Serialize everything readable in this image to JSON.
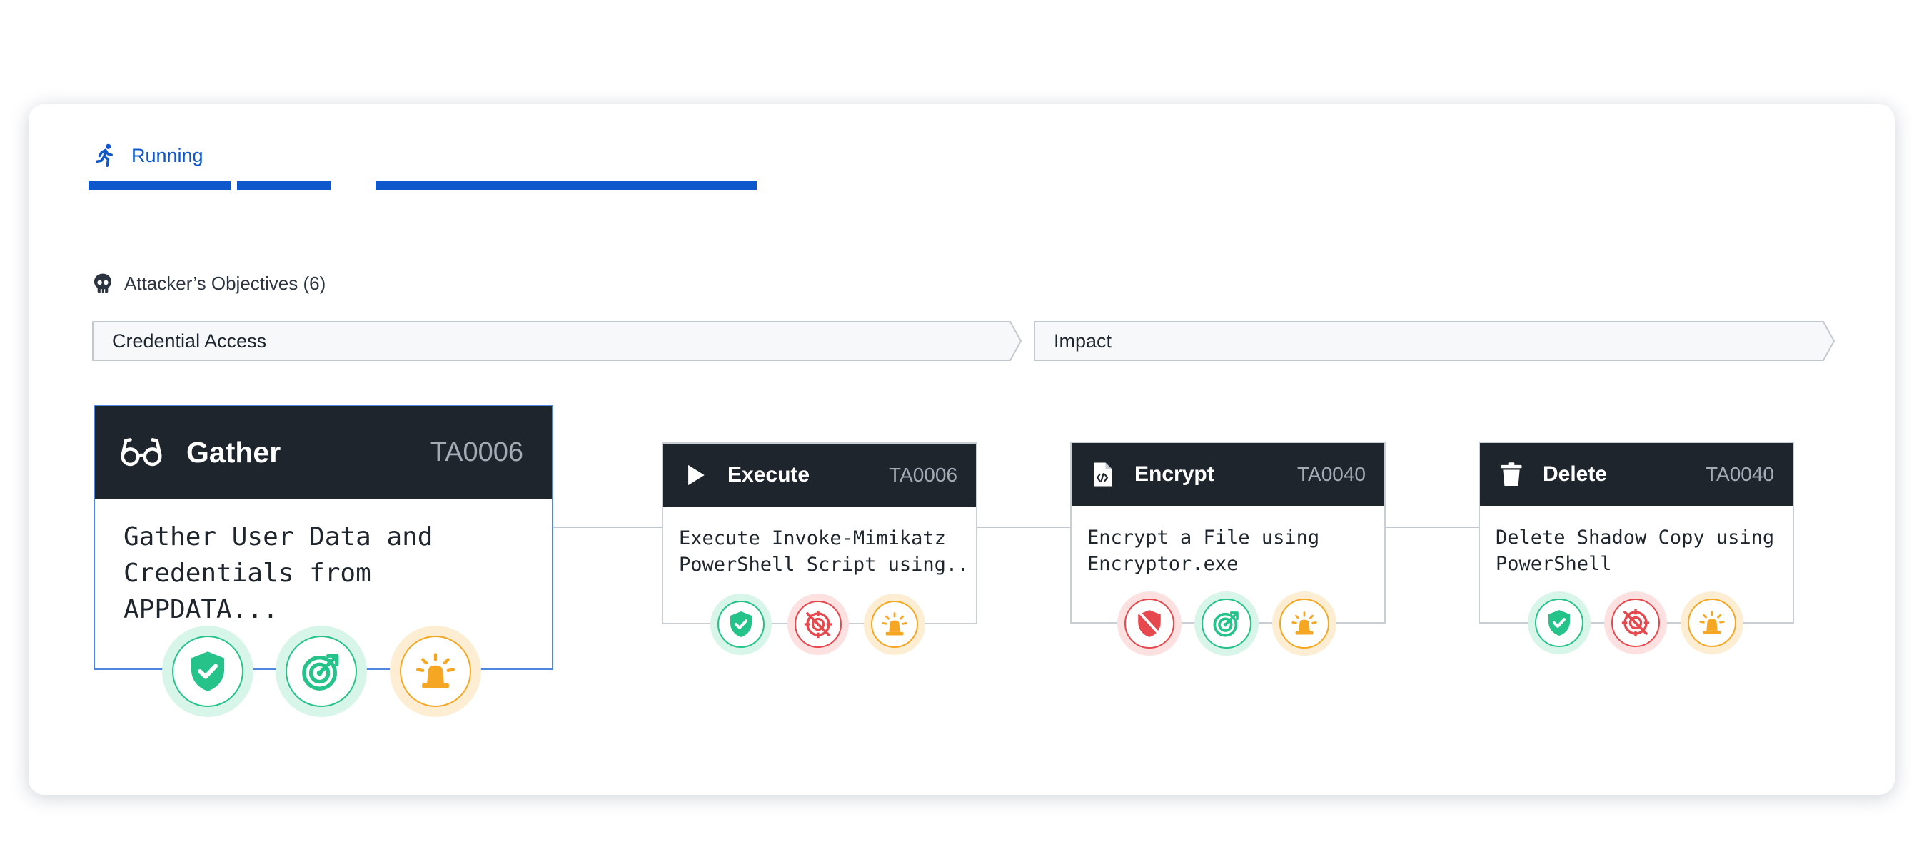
{
  "status": {
    "label": "Running",
    "icon": "running-person-icon",
    "color": "#0f58cc"
  },
  "objectives": {
    "label": "Attacker’s Objectives (6)",
    "icon": "skull-icon"
  },
  "tactics": [
    {
      "label": "Credential Access"
    },
    {
      "label": "Impact"
    }
  ],
  "steps": [
    {
      "title": "Gather",
      "code": "TA0006",
      "icon": "glasses-icon",
      "description": "Gather User Data and Credentials from APPDATA...",
      "indicators": [
        "shield-check-icon",
        "target-detect-icon",
        "alert-siren-icon"
      ]
    },
    {
      "title": "Execute",
      "code": "TA0006",
      "icon": "play-icon",
      "description": "Execute Invoke-Mimikatz PowerShell Script using..",
      "indicators": [
        "shield-check-icon",
        "target-off-icon",
        "alert-siren-icon"
      ]
    },
    {
      "title": "Encrypt",
      "code": "TA0040",
      "icon": "code-file-icon",
      "description": "Encrypt a File using Encryptor.exe",
      "indicators": [
        "shield-off-icon",
        "target-detect-icon",
        "alert-siren-icon"
      ]
    },
    {
      "title": "Delete",
      "code": "TA0040",
      "icon": "trash-icon",
      "description": "Delete Shadow Copy using PowerShell",
      "indicators": [
        "shield-check-icon",
        "target-off-icon",
        "alert-siren-icon"
      ]
    }
  ],
  "colors": {
    "accent": "#0f58cc",
    "success": "#25c28a",
    "danger": "#e5484d",
    "warning": "#f5a623",
    "card_header": "#1f252c"
  }
}
